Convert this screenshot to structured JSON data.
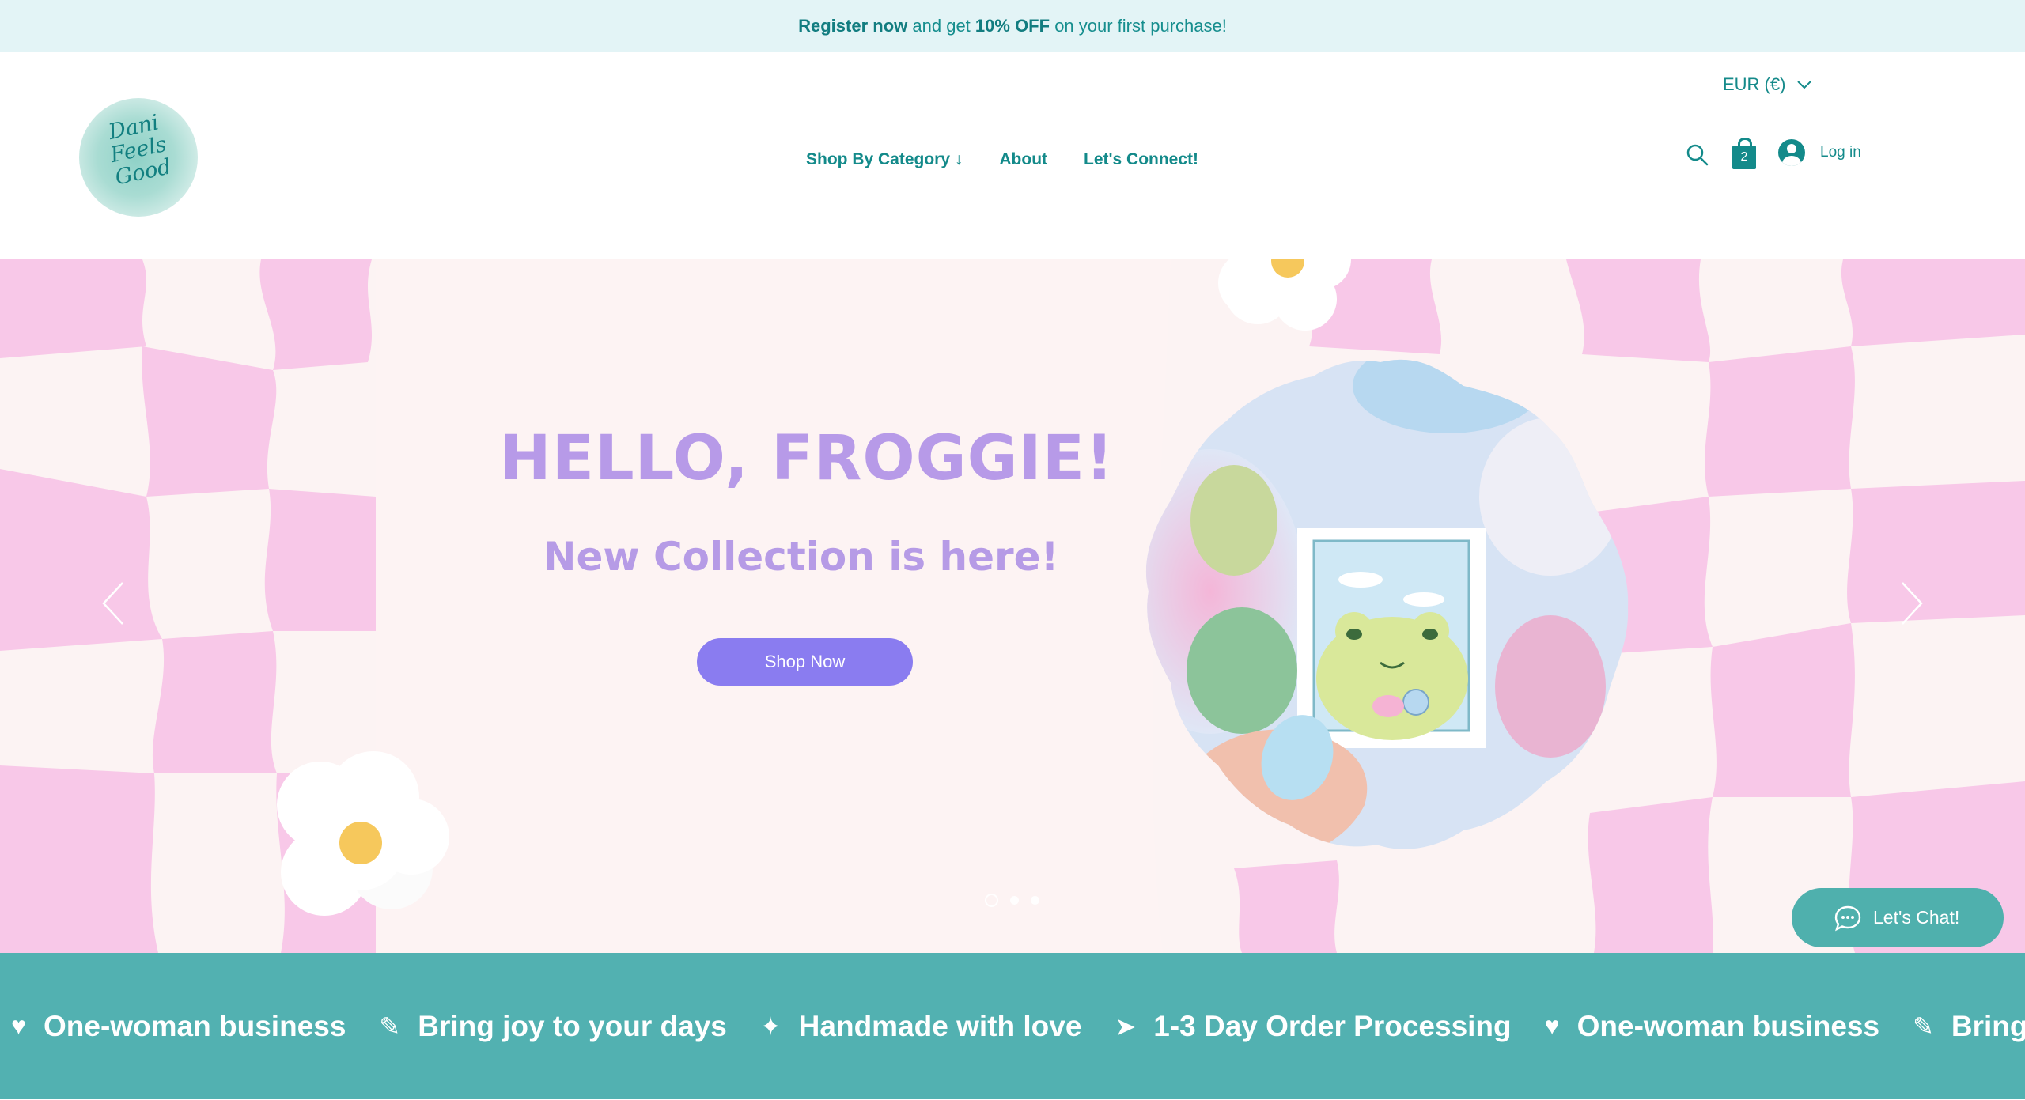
{
  "announcement": {
    "link_text": "Register now",
    "text_1": "and get",
    "discount": "10% OFF",
    "text_2": "on your first purchase!"
  },
  "header": {
    "logo_text": [
      "Dani",
      "Feels",
      "Good"
    ],
    "currency": "EUR (€)",
    "nav": [
      {
        "label": "Shop By Category ↓"
      },
      {
        "label": "About"
      },
      {
        "label": "Let's Connect!"
      }
    ],
    "cart_count": "2",
    "login_label": "Log in"
  },
  "hero": {
    "title": "HELLO, FROGGIE!",
    "subtitle": "New Collection is here!",
    "cta": "Shop Now",
    "slides": 3,
    "active_slide": 1
  },
  "chat": {
    "label": "Let's Chat!"
  },
  "ticker": [
    {
      "icon": "♥",
      "icon_name": "heart-icon",
      "text": "One-woman business"
    },
    {
      "icon": "✎",
      "icon_name": "pencil-icon",
      "text": "Bring joy to your days"
    },
    {
      "icon": "✦",
      "icon_name": "sparkle-icon",
      "text": "Handmade with love"
    },
    {
      "icon": "➤",
      "icon_name": "paper-plane-icon",
      "text": "1-3 Day Order Processing"
    },
    {
      "icon": "♥",
      "icon_name": "heart-icon",
      "text": "One-woman business"
    },
    {
      "icon": "✎",
      "icon_name": "pencil-icon",
      "text": "Bring joy to your days"
    }
  ],
  "colors": {
    "brand_teal": "#138a8a",
    "hero_purple": "#b79ae8",
    "button_purple": "#8a7cf0",
    "ticker_teal": "#52b1b1",
    "checker_pink": "#f8c8e8"
  }
}
